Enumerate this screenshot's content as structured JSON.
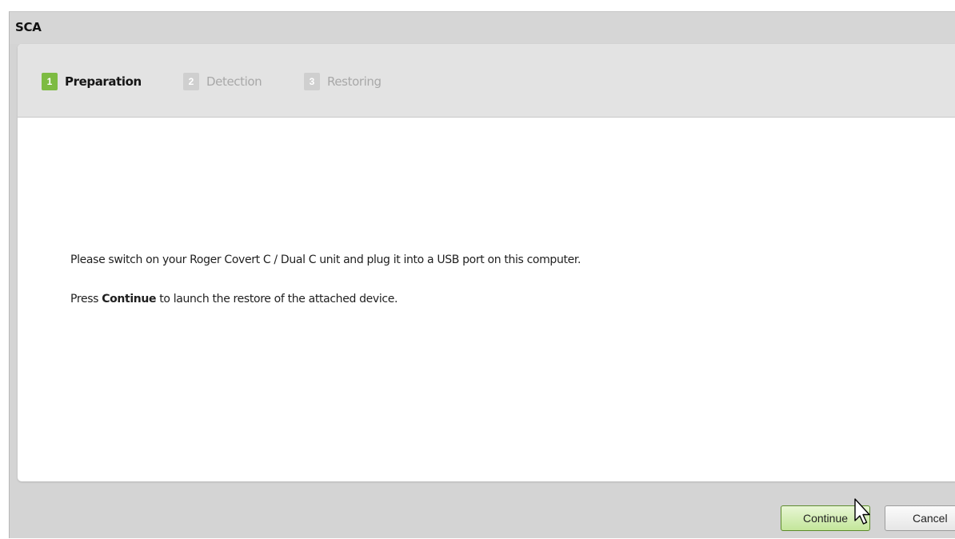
{
  "window": {
    "title": "SCA"
  },
  "steps": [
    {
      "number": "1",
      "label": "Preparation",
      "state": "active"
    },
    {
      "number": "2",
      "label": "Detection",
      "state": "inactive"
    },
    {
      "number": "3",
      "label": "Restoring",
      "state": "inactive"
    }
  ],
  "content": {
    "instruction": "Please switch on your Roger Covert C / Dual C unit and plug it into a USB port on this computer.",
    "press_prefix": "Press ",
    "press_bold": "Continue",
    "press_suffix": " to launch the restore of the attached device."
  },
  "buttons": {
    "continue_label": "Continue",
    "cancel_label": "Cancel"
  },
  "colors": {
    "active_step": "#7dbb42",
    "inactive_step": "#cfcfcf",
    "continue_button_border": "#5d8a2d"
  },
  "icons": {
    "cursor": "arrow-cursor-icon"
  }
}
